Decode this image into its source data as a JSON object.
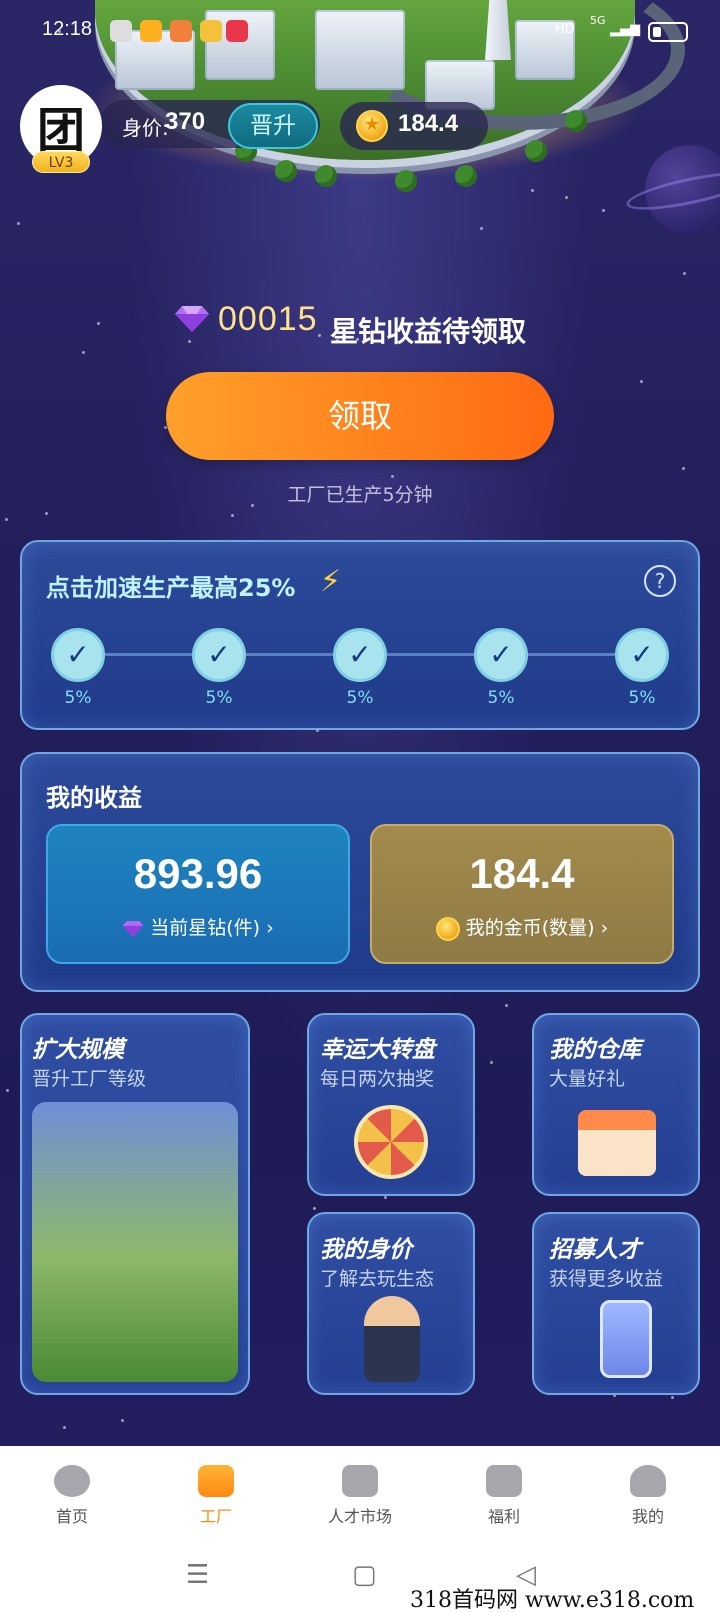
{
  "status_bar": {
    "time": "12:18",
    "network": "5G",
    "hd": "HD"
  },
  "profile": {
    "avatar_char": "团",
    "level": "LV3",
    "worth_label": "身价:",
    "worth_value": "370",
    "promote_label": "晋升",
    "coins": "184.4"
  },
  "pending": {
    "amount": "00015",
    "text": "星钻收益待领取",
    "claim_label": "领取",
    "produced_text": "工厂已生产5分钟"
  },
  "speedup": {
    "title": "点击加速生产最高25%",
    "steps": [
      {
        "label": "5%"
      },
      {
        "label": "5%"
      },
      {
        "label": "5%"
      },
      {
        "label": "5%"
      },
      {
        "label": "5%"
      }
    ]
  },
  "earnings": {
    "title": "我的收益",
    "diamonds_value": "893.96",
    "diamonds_label": "当前星钻(件)",
    "coins_value": "184.4",
    "coins_label": "我的金币(数量)"
  },
  "tiles": {
    "expand": {
      "title": "扩大规模",
      "sub": "晋升工厂等级"
    },
    "wheel": {
      "title": "幸运大转盘",
      "sub": "每日两次抽奖"
    },
    "warehouse": {
      "title": "我的仓库",
      "sub": "大量好礼"
    },
    "worth": {
      "title": "我的身价",
      "sub": "了解去玩生态"
    },
    "recruit": {
      "title": "招募人才",
      "sub": "获得更多收益"
    }
  },
  "bottom_nav": [
    {
      "label": "首页",
      "icon": "planet-icon"
    },
    {
      "label": "工厂",
      "icon": "home-icon"
    },
    {
      "label": "人才市场",
      "icon": "store-icon"
    },
    {
      "label": "福利",
      "icon": "gift-icon"
    },
    {
      "label": "我的",
      "icon": "user-icon"
    }
  ],
  "watermark": "318首码网 www.e318.com",
  "colors": {
    "accent_orange": "#ff8a10",
    "card_border": "#6fa7e4",
    "pending_number": "#ffe38a"
  }
}
